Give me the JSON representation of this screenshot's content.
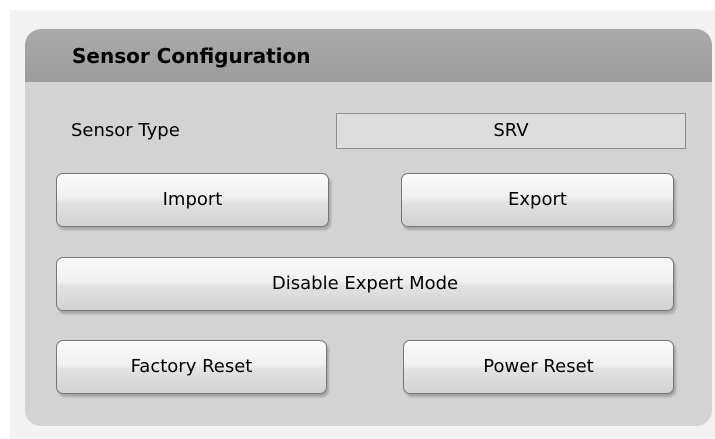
{
  "panel": {
    "title": "Sensor Configuration"
  },
  "sensor_type": {
    "label": "Sensor Type",
    "value": "SRV"
  },
  "buttons": {
    "import": "Import",
    "export": "Export",
    "disable_expert_mode": "Disable Expert Mode",
    "factory_reset": "Factory Reset",
    "power_reset": "Power Reset"
  },
  "colors": {
    "panel_background": "#d3d3d3",
    "header_background": "#a3a3a3",
    "field_background": "#dddddd"
  }
}
